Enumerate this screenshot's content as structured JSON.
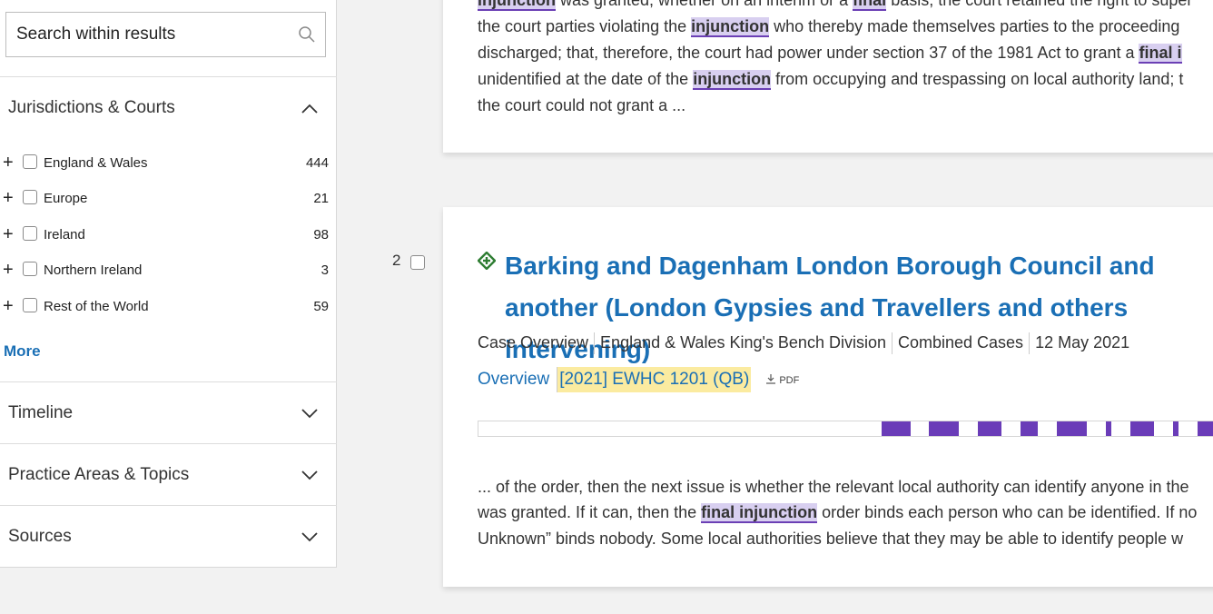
{
  "sidebar": {
    "search_placeholder": "Search within results",
    "jurisdictions": {
      "title": "Jurisdictions & Courts",
      "items": [
        {
          "label": "England & Wales",
          "count": "444"
        },
        {
          "label": "Europe",
          "count": "21"
        },
        {
          "label": "Ireland",
          "count": "98"
        },
        {
          "label": "Northern Ireland",
          "count": "3"
        },
        {
          "label": "Rest of the World",
          "count": "59"
        }
      ],
      "more": "More"
    },
    "timeline": "Timeline",
    "practice_areas": "Practice Areas & Topics",
    "sources": "Sources"
  },
  "result1": {
    "lines": [
      [
        "injunction",
        " was granted, whether on an interim or a ",
        "final",
        " basis, the court retained the right to super"
      ],
      [
        "the court parties violating the ",
        "injunction",
        " who thereby made themselves parties to the proceeding"
      ],
      [
        "discharged; that, therefore, the court had power under section 37 of the 1981 Act to grant a ",
        "final i"
      ],
      [
        "unidentified at the date of the ",
        "injunction",
        " from occupying and trespassing on local authority land; t"
      ],
      [
        "the court could not grant a ..."
      ]
    ]
  },
  "result2": {
    "number": "2",
    "title": "Barking and Dagenham London Borough Council and another (London Gypsies and Travellers and others intervening)",
    "meta": [
      "Case Overview",
      "England & Wales King's Bench Division",
      "Combined Cases",
      "12 May 2021"
    ],
    "overview": "Overview",
    "citation": "[2021] EWHC 1201 (QB)",
    "pdf": "PDF",
    "lines": [
      [
        "... of the order, then the next issue is whether the relevant local authority can identify anyone in the"
      ],
      [
        "was granted. If it can, then the ",
        "final injunction",
        " order binds each person who can be identified. If no"
      ],
      [
        "Unknown” binds nobody. Some local authorities believe that they may be able to identify people w"
      ]
    ]
  },
  "colors": {
    "accent": "#1a6fb5",
    "highlight": "#d8cff0",
    "citation_bg": "#fbeba0",
    "bar": "#6a3cb8"
  }
}
